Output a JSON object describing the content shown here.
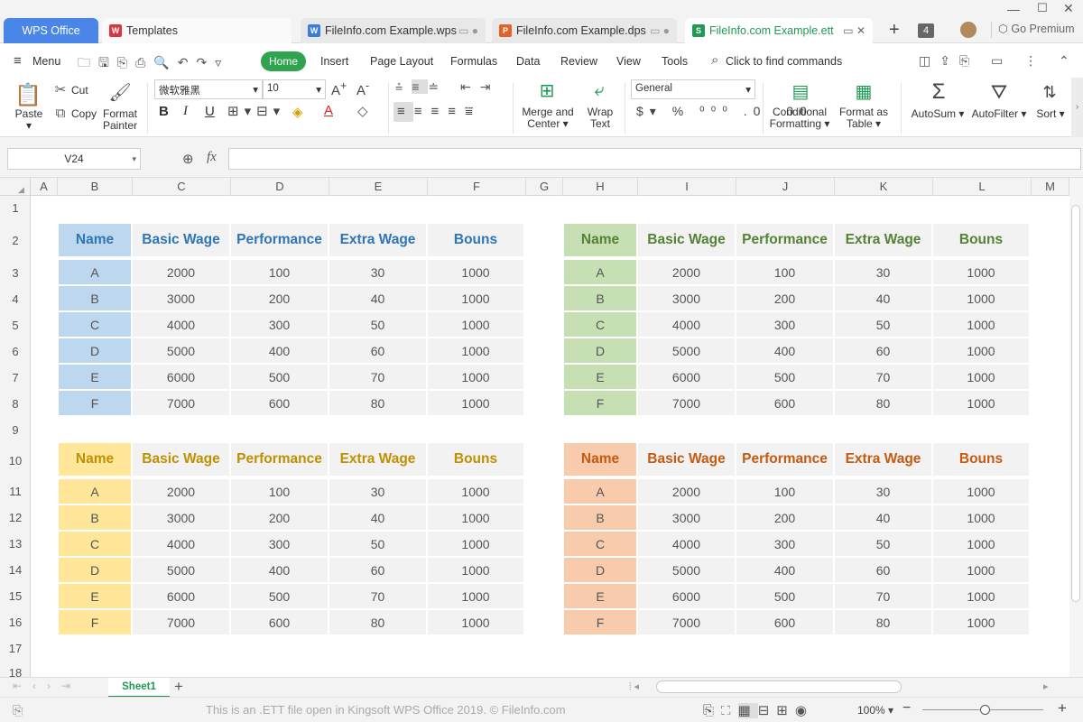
{
  "tabs": {
    "wps": "WPS Office",
    "templates": "Templates",
    "wps_doc": "FileInfo.com Example.wps",
    "dps_doc": "FileInfo.com Example.dps",
    "ett_doc": "FileInfo.com Example.ett",
    "tab_count": "4",
    "premium": "Go Premium"
  },
  "menu": {
    "menu_label": "Menu",
    "items": [
      "Home",
      "Insert",
      "Page Layout",
      "Formulas",
      "Data",
      "Review",
      "View",
      "Tools"
    ],
    "search": "Click to find commands"
  },
  "ribbon": {
    "paste": "Paste",
    "cut": "Cut",
    "copy": "Copy",
    "format_painter_1": "Format",
    "format_painter_2": "Painter",
    "font_name": "微软雅黑",
    "font_size": "10",
    "merge_1": "Merge and",
    "merge_2": "Center",
    "wrap_1": "Wrap",
    "wrap_2": "Text",
    "number_format": "General",
    "cond_1": "Conditional",
    "cond_2": "Formatting",
    "fat_1": "Format as",
    "fat_2": "Table",
    "autosum": "AutoSum",
    "autofilter": "AutoFilter",
    "sort": "Sort"
  },
  "formula_bar": {
    "cell_ref": "V24",
    "fx": "fx",
    "value": ""
  },
  "columns": [
    "A",
    "B",
    "C",
    "D",
    "E",
    "F",
    "G",
    "H",
    "I",
    "J",
    "K",
    "L",
    "M"
  ],
  "rows": [
    "1",
    "2",
    "3",
    "4",
    "5",
    "6",
    "7",
    "8",
    "9",
    "10",
    "11",
    "12",
    "13",
    "14",
    "15",
    "16",
    "17",
    "18"
  ],
  "table": {
    "headers": [
      "Name",
      "Basic Wage",
      "Performance",
      "Extra Wage",
      "Bouns"
    ],
    "rows": [
      [
        "A",
        "2000",
        "100",
        "30",
        "1000"
      ],
      [
        "B",
        "3000",
        "200",
        "40",
        "1000"
      ],
      [
        "C",
        "4000",
        "300",
        "50",
        "1000"
      ],
      [
        "D",
        "5000",
        "400",
        "60",
        "1000"
      ],
      [
        "E",
        "6000",
        "500",
        "70",
        "1000"
      ],
      [
        "F",
        "7000",
        "600",
        "80",
        "1000"
      ]
    ]
  },
  "theme_colors": {
    "blue": {
      "text": "#2e75b6",
      "name_bg": "#bdd7ee"
    },
    "green": {
      "text": "#548235",
      "name_bg": "#c6e0b4"
    },
    "yellow": {
      "text": "#bf9000",
      "name_bg": "#ffe699"
    },
    "orange": {
      "text": "#c55a11",
      "name_bg": "#f8cbad"
    }
  },
  "sheet_tab": "Sheet1",
  "status": {
    "message": "This is an .ETT file open in Kingsoft WPS Office 2019. © FileInfo.com",
    "zoom": "100%"
  }
}
